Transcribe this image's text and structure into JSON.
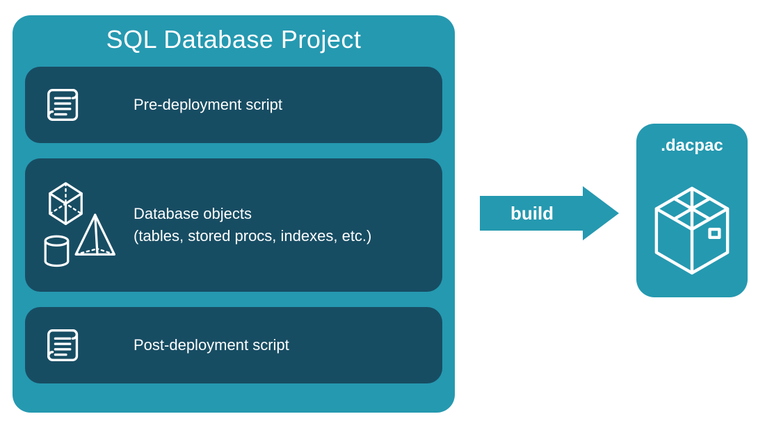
{
  "project": {
    "title": "SQL Database Project",
    "sections": [
      {
        "label_line1": "Pre-deployment script",
        "label_line2": ""
      },
      {
        "label_line1": "Database objects",
        "label_line2": "(tables, stored procs, indexes, etc.)"
      },
      {
        "label_line1": "Post-deployment script",
        "label_line2": ""
      }
    ]
  },
  "arrow": {
    "label": "build"
  },
  "output": {
    "filetype": ".dacpac"
  },
  "colors": {
    "outer": "#2599b0",
    "inner": "#174d63",
    "stroke": "#ffffff"
  }
}
